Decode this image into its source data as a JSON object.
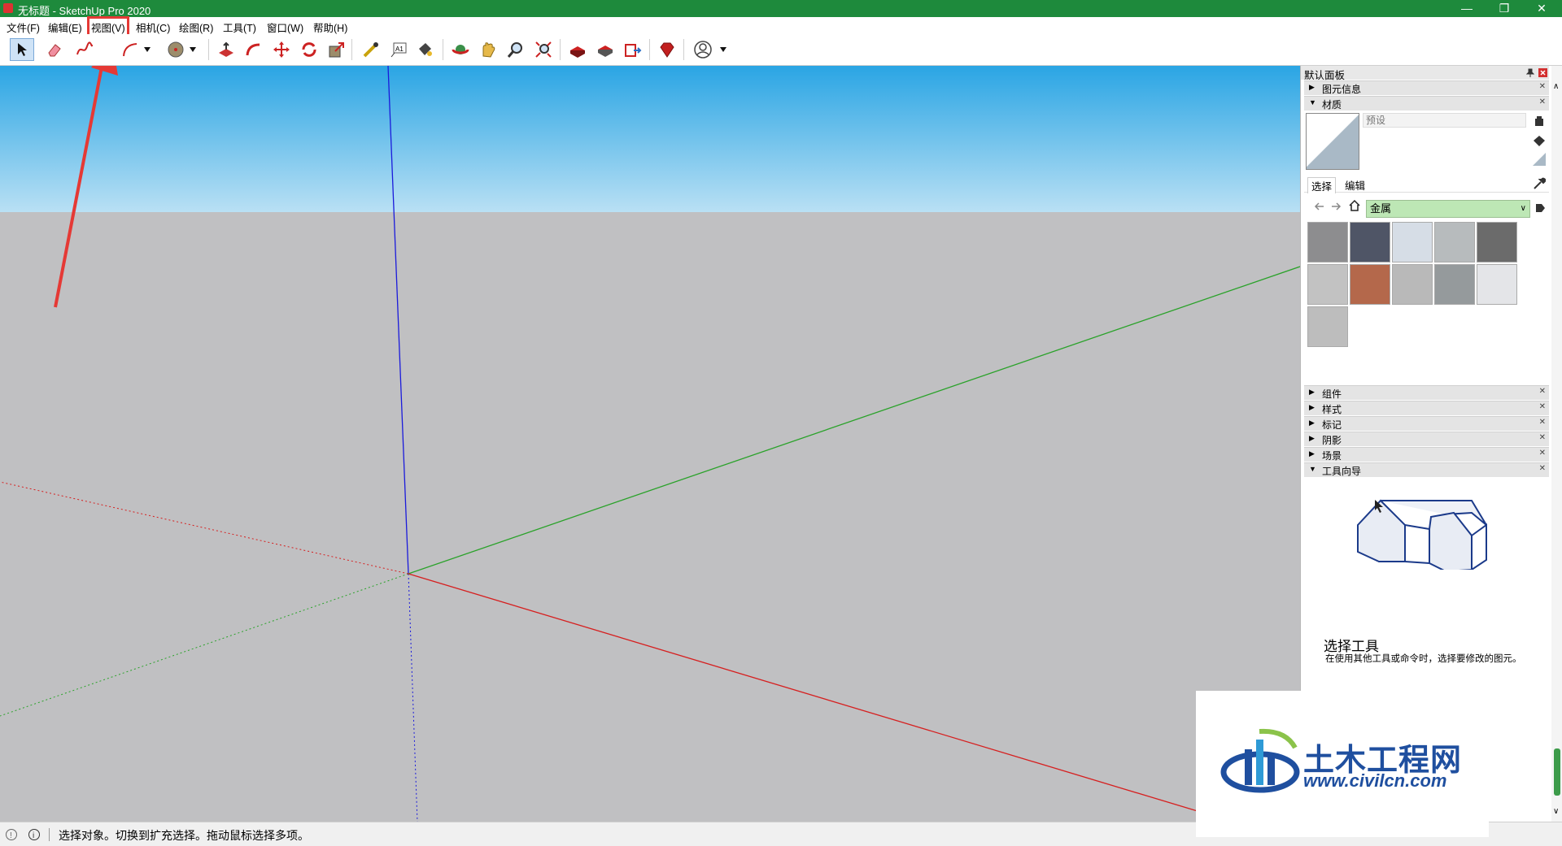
{
  "window": {
    "title": "无标题 - SketchUp Pro 2020",
    "minimize": "—",
    "restore": "❐",
    "close": "✕"
  },
  "menu": [
    "文件(F)",
    "编辑(E)",
    "视图(V)",
    "相机(C)",
    "绘图(R)",
    "工具(T)",
    "窗口(W)",
    "帮助(H)"
  ],
  "highlighted_menu": "视图(V)",
  "toolbar": {
    "tools": [
      "select-icon",
      "eraser-icon",
      "freehand-icon",
      "arc-icon",
      "dropdown-icon",
      "circle-icon",
      "dropdown-icon",
      "pushpull-icon",
      "follow-me-icon",
      "move-icon",
      "rotate-icon",
      "scale-icon",
      "tape-measure-icon",
      "text-icon",
      "paint-bucket-icon",
      "orbit-icon",
      "pan-icon",
      "zoom-icon",
      "zoom-extents-icon",
      "warehouse-icon",
      "extension-warehouse-icon",
      "send-to-layout-icon",
      "ruby-icon",
      "account-icon",
      "dropdown-icon"
    ]
  },
  "panel": {
    "title": "默认面板",
    "trays_top": [
      {
        "label": "图元信息",
        "expanded": false
      },
      {
        "label": "材质",
        "expanded": true
      }
    ],
    "materials": {
      "name_placeholder": "预设",
      "tabs": [
        "选择",
        "编辑"
      ],
      "library": "金属",
      "swatch_colors": [
        "#8d8d8f",
        "#4f5566",
        "#d6dde6",
        "#b7bbbd",
        "#6b6b6b",
        "#c2c2c2",
        "#b4684b",
        "#b9b9b9",
        "#959a9c",
        "#e4e5e8",
        "#bdbdbd"
      ]
    },
    "trays_bottom": [
      {
        "label": "组件",
        "expanded": false
      },
      {
        "label": "样式",
        "expanded": false
      },
      {
        "label": "标记",
        "expanded": false
      },
      {
        "label": "阴影",
        "expanded": false
      },
      {
        "label": "场景",
        "expanded": false
      },
      {
        "label": "工具向导",
        "expanded": true
      }
    ],
    "guide": {
      "title": "选择工具",
      "text": "在使用其他工具或命令时，选择要修改的图元。"
    }
  },
  "status": {
    "text": "选择对象。切换到扩充选择。拖动鼠标选择多项。"
  },
  "watermark": {
    "name": "土木工程网",
    "url": "www.civilcn.com"
  }
}
